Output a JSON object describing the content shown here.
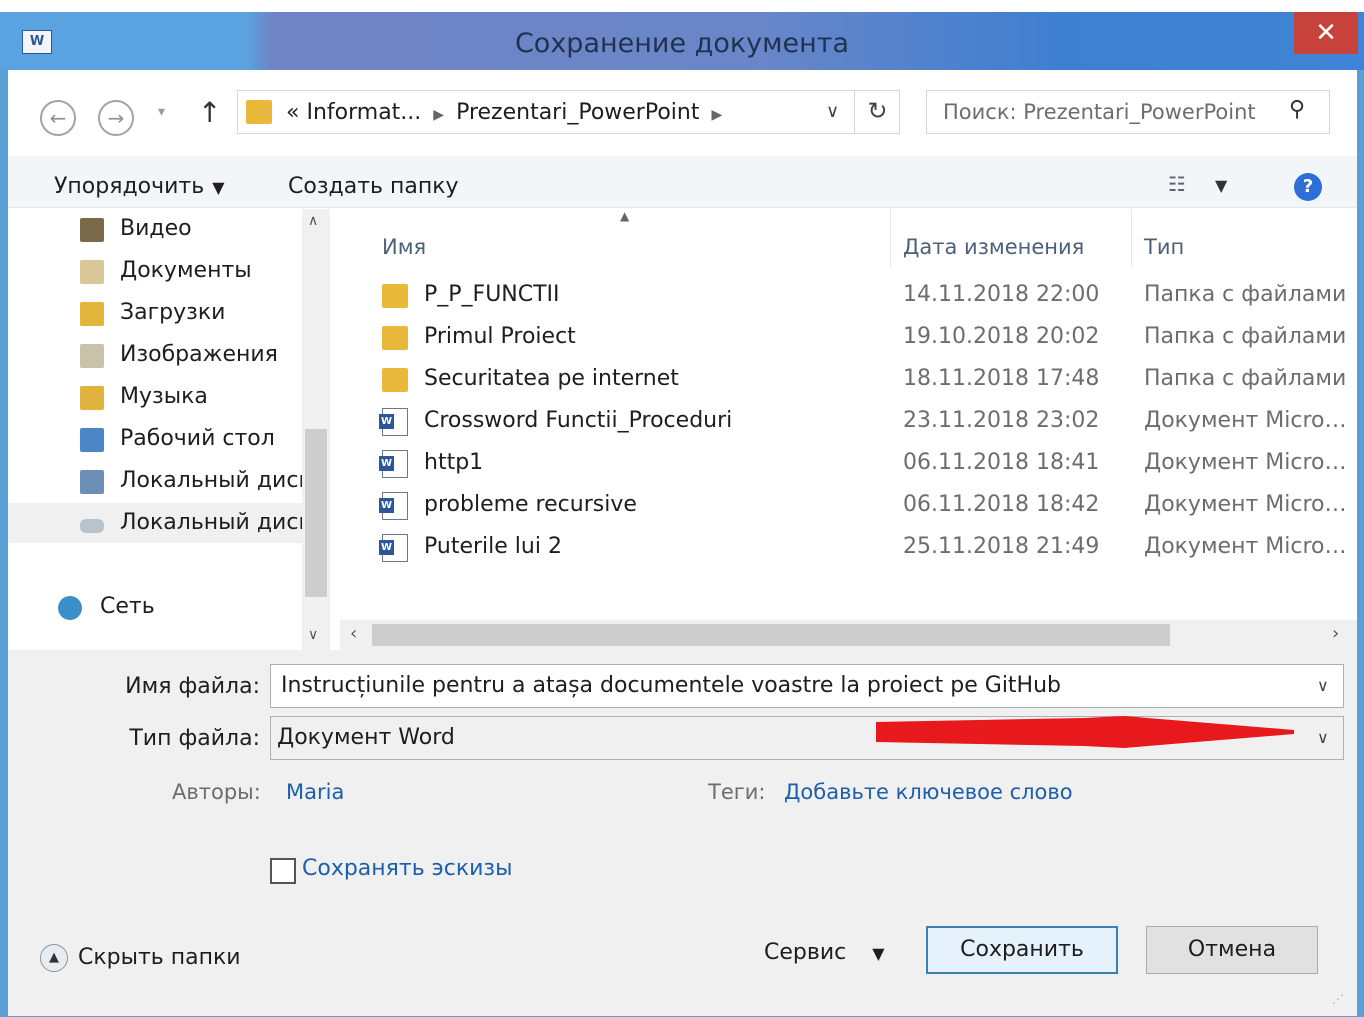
{
  "window": {
    "title": "Сохранение документа",
    "app_icon": "word-icon",
    "close_glyph": "✕"
  },
  "address_bar": {
    "back_glyph": "←",
    "forward_glyph": "→",
    "up_glyph": "↑",
    "chevron": "«",
    "path": [
      "Informat...",
      "Prezentari_PowerPoint"
    ],
    "search_placeholder": "Поиск: Prezentari_PowerPoint"
  },
  "toolbar": {
    "organize_label": "Упорядочить",
    "new_folder_label": "Создать папку"
  },
  "nav_pane": {
    "items": [
      {
        "label": "Видео",
        "icon": "video-icon"
      },
      {
        "label": "Документы",
        "icon": "documents-icon"
      },
      {
        "label": "Загрузки",
        "icon": "downloads-icon"
      },
      {
        "label": "Изображения",
        "icon": "pictures-icon"
      },
      {
        "label": "Музыка",
        "icon": "music-icon"
      },
      {
        "label": "Рабочий стол",
        "icon": "desktop-icon"
      },
      {
        "label": "Локальный диск",
        "icon": "local-disk-icon"
      },
      {
        "label": "Локальный диск",
        "icon": "drive-icon"
      }
    ],
    "network_label": "Сеть"
  },
  "file_list": {
    "columns": {
      "name": "Имя",
      "date": "Дата изменения",
      "type": "Тип"
    },
    "rows": [
      {
        "name": "P_P_FUNCTII",
        "date": "14.11.2018 22:00",
        "type": "Папка с файлами",
        "icon": "folder"
      },
      {
        "name": "Primul Proiect",
        "date": "19.10.2018 20:02",
        "type": "Папка с файлами",
        "icon": "folder"
      },
      {
        "name": "Securitatea pe internet",
        "date": "18.11.2018 17:48",
        "type": "Папка с файлами",
        "icon": "folder"
      },
      {
        "name": "Crossword Functii_Proceduri",
        "date": "23.11.2018 23:02",
        "type": "Документ Micros...",
        "icon": "doc"
      },
      {
        "name": "http1",
        "date": "06.11.2018 18:41",
        "type": "Документ Micros...",
        "icon": "doc"
      },
      {
        "name": "probleme recursive",
        "date": "06.11.2018 18:42",
        "type": "Документ Micros...",
        "icon": "doc"
      },
      {
        "name": "Puterile lui 2",
        "date": "25.11.2018 21:49",
        "type": "Документ Micros...",
        "icon": "doc"
      }
    ]
  },
  "form": {
    "filename_label": "Имя файла:",
    "filename_value": "Instrucțiunile pentru a atașa documentele voastre la proiect pe GitHub",
    "filetype_label": "Тип файла:",
    "filetype_value": "Документ Word",
    "authors_label": "Авторы:",
    "authors_value": "Maria",
    "tags_label": "Теги:",
    "tags_value": "Добавьте ключевое слово",
    "thumbnails_label": "Сохранять эскизы",
    "thumbnails_checked": false
  },
  "footer": {
    "hide_folders_label": "Скрыть папки",
    "service_label": "Сервис",
    "save_label": "Сохранить",
    "cancel_label": "Отмена"
  },
  "colors": {
    "title_bar": "#6a86c8",
    "close_button": "#c7423b",
    "link": "#1b5fad",
    "folder": "#e9b93b",
    "annotation_arrow": "#e8191c"
  }
}
